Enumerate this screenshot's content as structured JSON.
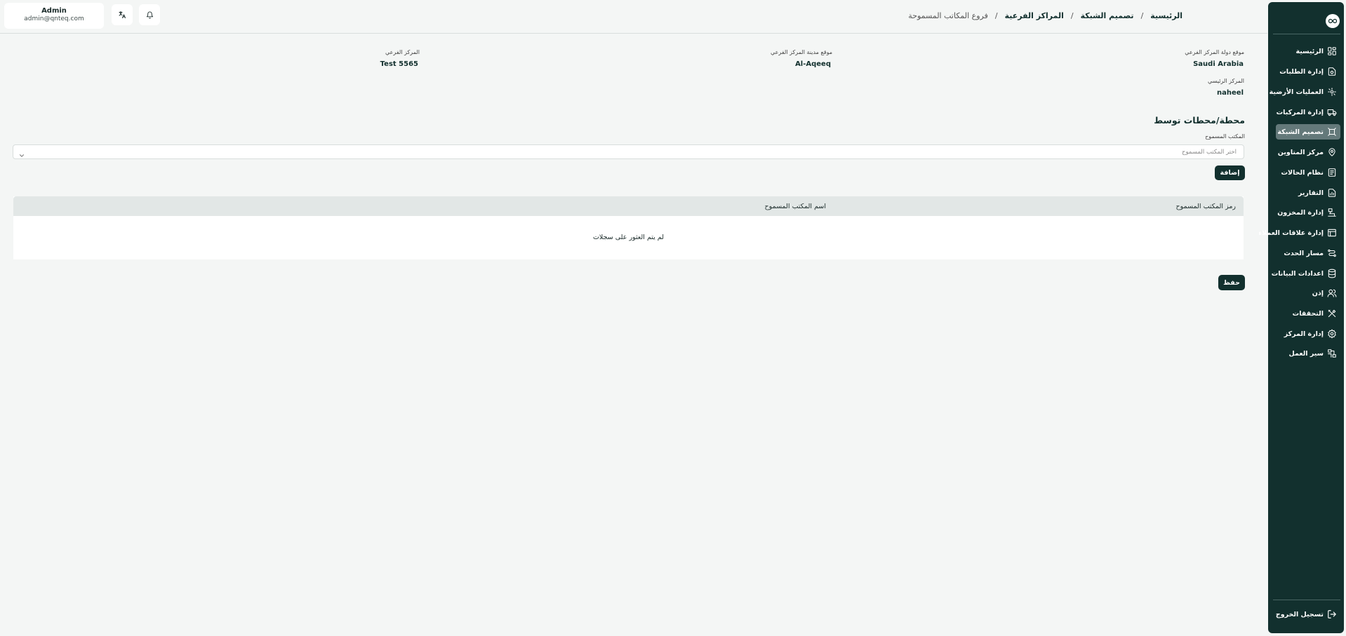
{
  "user": {
    "name": "Admin",
    "email": "admin@qnteq.com"
  },
  "breadcrumb": {
    "home": "الرئيسية",
    "network_design": "تصميم الشبكة",
    "branch_centers": "المراكز الفرعية",
    "current": "فروع المكاتب المسموحة",
    "separator": "/"
  },
  "sidebar": {
    "items": [
      {
        "label": "الرئيسية",
        "icon": "dashboard-icon"
      },
      {
        "label": "إدارة الطلبات",
        "icon": "orders-icon"
      },
      {
        "label": "العمليات الأرضية",
        "icon": "ground-ops-icon"
      },
      {
        "label": "إدارة المركبات",
        "icon": "truck-icon"
      },
      {
        "label": "تصميم الشبكة",
        "icon": "network-icon"
      },
      {
        "label": "مركز المتاوين",
        "icon": "location-pin-icon"
      },
      {
        "label": "نظام الحالات",
        "icon": "status-system-icon"
      },
      {
        "label": "التقارير",
        "icon": "reports-icon"
      },
      {
        "label": "إدارة المخزون",
        "icon": "inventory-icon"
      },
      {
        "label": "إدارة علاقات العملاء",
        "icon": "crm-icon"
      },
      {
        "label": "مسار الحدث",
        "icon": "route-icon"
      },
      {
        "label": "اعدادات البيانات",
        "icon": "database-icon"
      },
      {
        "label": "إذن",
        "icon": "users-icon"
      },
      {
        "label": "التحققات",
        "icon": "tools-icon"
      },
      {
        "label": "إدارة المركز",
        "icon": "center-settings-icon"
      },
      {
        "label": "سير العمل",
        "icon": "workflow-icon"
      }
    ],
    "active_index": 4,
    "logout": "تسجيل الخروج"
  },
  "info": {
    "country_label": "موقع دولة المركز الفرعي",
    "country_value": "Saudi Arabia",
    "city_label": "موقع مدينة المركز الفرعي",
    "city_value": "Al-Aqeeq",
    "branch_label": "المركز الفرعي",
    "branch_value": "Test 5565",
    "main_center_label": "المركز الرئيسي",
    "main_center_value": "naheel"
  },
  "form": {
    "section_title": "محطة/محطات توسط",
    "field_label": "المكتب المسموح",
    "select_placeholder": "اختر المكتب المسموح",
    "add_button": "إضافة",
    "save_button": "حفظ"
  },
  "table": {
    "columns": [
      "رمز المكتب المسموح",
      "اسم المكتب المسموح"
    ],
    "empty_message": "لم يتم العثور على سجلات"
  },
  "colors": {
    "sidebar_bg": "#12302e",
    "active_item_bg": "#64797a",
    "header_row_bg": "#e2e7e6",
    "page_bg": "#f4f6f5"
  }
}
